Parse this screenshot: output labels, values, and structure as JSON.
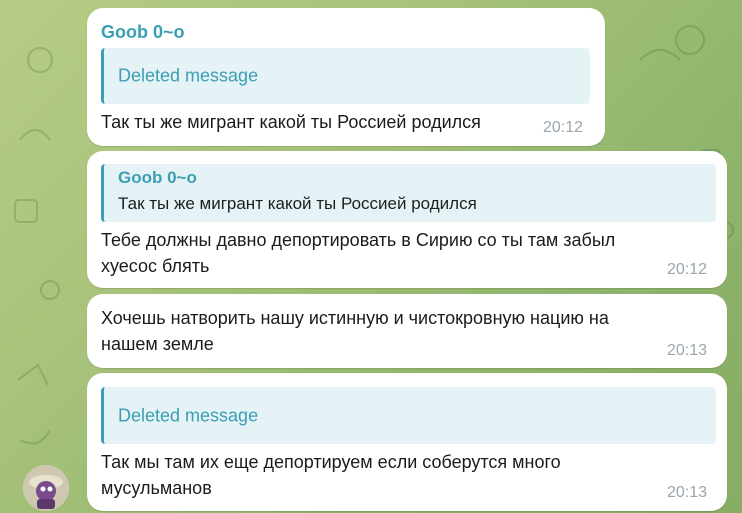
{
  "messages": [
    {
      "sender": "Goob 0~o",
      "reply_deleted": "Deleted message",
      "text": "Так ты же мигрант какой ты Россией родился",
      "time": "20:12"
    },
    {
      "reply_author": "Goob 0~o",
      "reply_text": "Так ты же мигрант какой ты Россией родился",
      "text_line1": "Тебе должны давно депортировать в Сирию со ты там забыл",
      "text_line2": "хуесос блять",
      "time": "20:12"
    },
    {
      "text_line1": "Хочешь натворить нашу истинную и чистокровную нацию на",
      "text_line2": "нашем земле",
      "time": "20:13"
    },
    {
      "reply_deleted": "Deleted message",
      "text_line1": "Так мы там их еще депортируем если соберутся много",
      "text_line2": "мусульманов",
      "time": "20:13"
    }
  ],
  "icons": {
    "avatar": "user-avatar-icon"
  },
  "colors": {
    "accent": "#3a9fb3",
    "bubble": "#ffffff",
    "reply_bg": "#e6f3f6",
    "time": "#9aa6ad"
  }
}
